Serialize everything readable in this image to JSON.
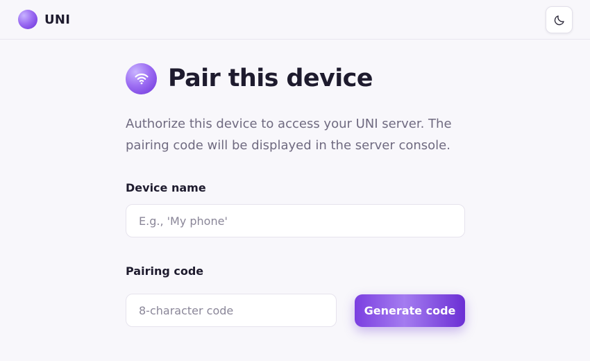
{
  "app": {
    "name": "UNI"
  },
  "header": {
    "theme_toggle_icon": "moon-icon"
  },
  "page": {
    "title": "Pair this device",
    "title_icon": "wifi-icon",
    "description": "Authorize this device to access your UNI server. The pairing code will be displayed in the server console."
  },
  "form": {
    "device_name": {
      "label": "Device name",
      "placeholder": "E.g., 'My phone'",
      "value": ""
    },
    "pairing_code": {
      "label": "Pairing code",
      "placeholder": "8-character code",
      "value": ""
    },
    "generate_button": "Generate code"
  },
  "colors": {
    "accent": "#7b3fe0",
    "background": "#f8f7fb",
    "text": "#1e1b2e",
    "muted": "#6f6a80"
  }
}
